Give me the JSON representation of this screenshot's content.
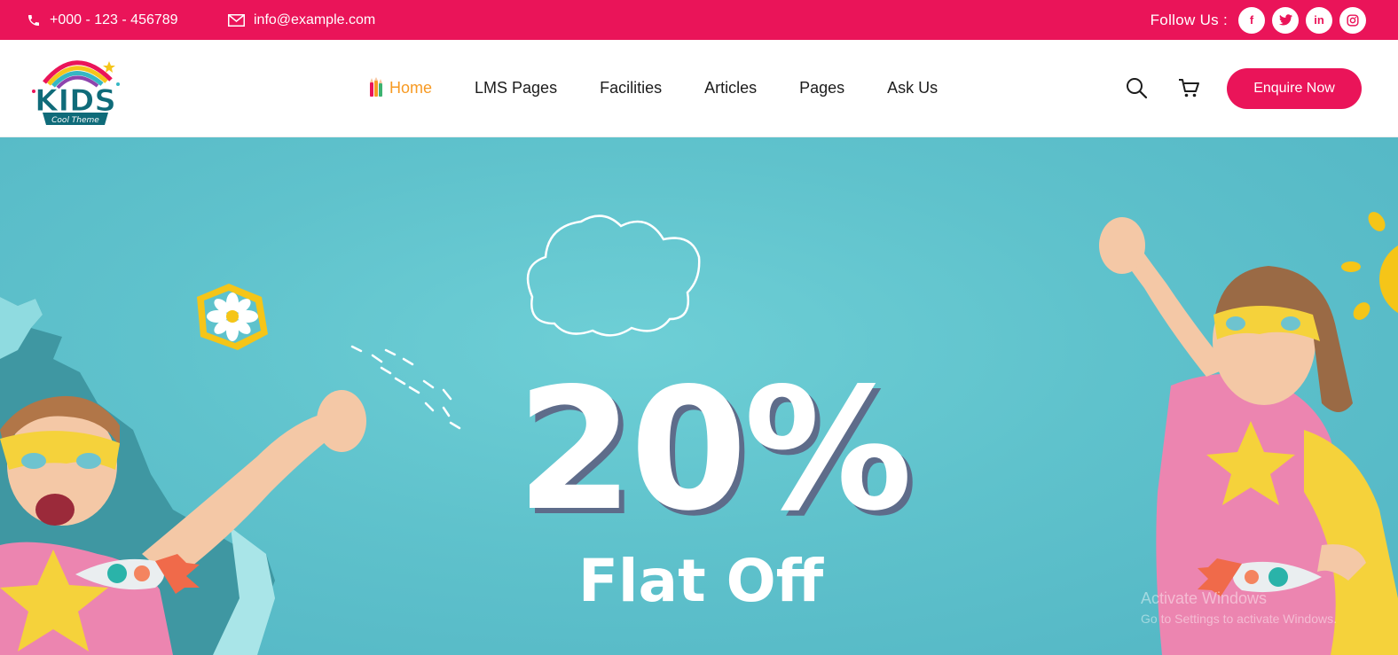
{
  "topbar": {
    "phone": "+000 - 123 - 456789",
    "email": "info@example.com",
    "follow_label": "Follow Us :",
    "socials": [
      {
        "icon": "facebook-icon",
        "glyph": "f"
      },
      {
        "icon": "twitter-icon",
        "glyph": "t"
      },
      {
        "icon": "linkedin-icon",
        "glyph": "in"
      },
      {
        "icon": "instagram-icon",
        "glyph": "◎"
      }
    ]
  },
  "header": {
    "logo_title": "KIDS",
    "logo_subtitle": "Cool Theme",
    "nav": [
      {
        "label": "Home",
        "active": true
      },
      {
        "label": "LMS Pages",
        "active": false
      },
      {
        "label": "Facilities",
        "active": false
      },
      {
        "label": "Articles",
        "active": false
      },
      {
        "label": "Pages",
        "active": false
      },
      {
        "label": "Ask Us",
        "active": false
      }
    ],
    "enquire_label": "Enquire Now"
  },
  "hero": {
    "headline": "20%",
    "subheadline": "Flat Off",
    "watermark_title": "Activate Windows",
    "watermark_sub": "Go to Settings to activate Windows."
  },
  "colors": {
    "brand": "#ea1459",
    "accent": "#f79a23",
    "hero_bg": "#5fc2cc"
  }
}
